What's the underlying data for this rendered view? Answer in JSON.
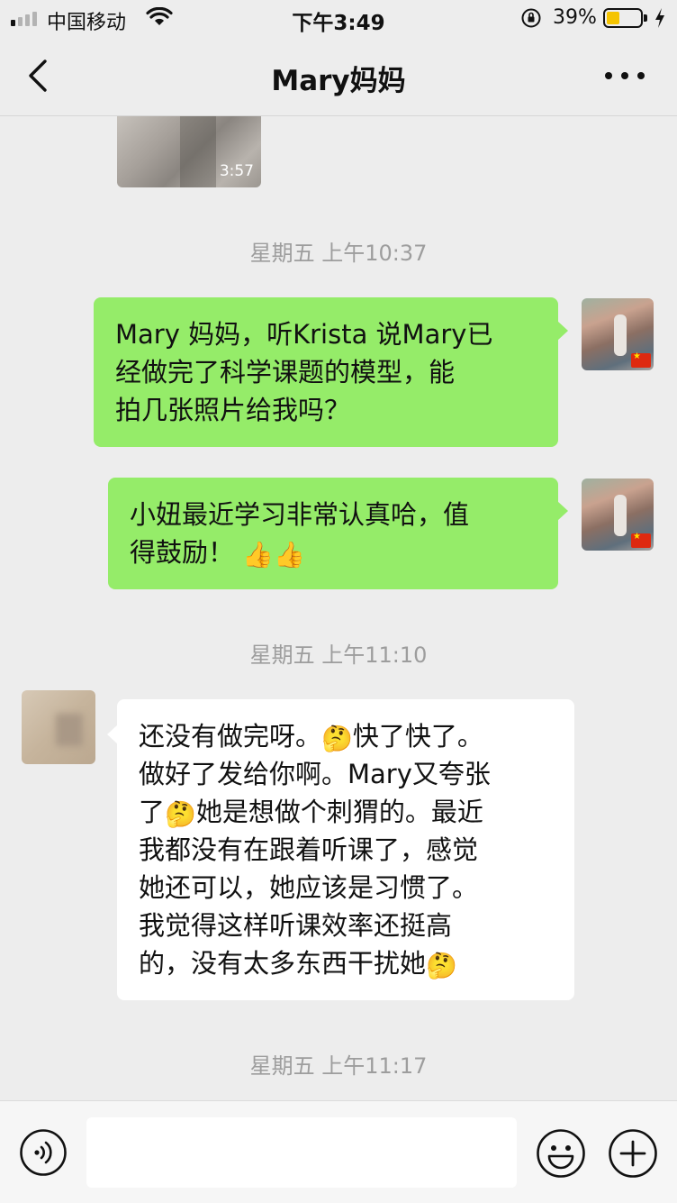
{
  "status_bar": {
    "carrier": "中国移动",
    "time": "下午3:49",
    "battery_percent_text": "39%",
    "battery_level": 0.39,
    "signal_bars_active": 1,
    "signal_bars_total": 4,
    "icons": [
      "signal-icon",
      "wifi-icon",
      "orientation-lock-icon",
      "battery-icon",
      "charging-bolt-icon"
    ]
  },
  "nav": {
    "title": "Mary妈妈",
    "back_icon": "chevron-left-icon",
    "more_icon": "more-dots-icon"
  },
  "chat": {
    "video": {
      "duration": "3:57"
    },
    "timestamps": [
      "星期五 上午10:37",
      "星期五 上午11:10",
      "星期五 上午11:17"
    ],
    "messages": [
      {
        "sender": "self",
        "lines": [
          "Mary 妈妈，听Krista 说Mary已",
          "经做完了科学课题的模型，能",
          "拍几张照片给我吗？"
        ]
      },
      {
        "sender": "self",
        "lines": [
          "小妞最近学习非常认真哈，值",
          "得鼓励！"
        ],
        "emoji": "👍👍"
      },
      {
        "sender": "other",
        "line1_a": "还没有做完呀。",
        "line1_b": "快了快了。",
        "line2": "做好了发给你啊。Mary又夸张",
        "line3_a": "了",
        "line3_b": "她是想做个刺猬的。最近",
        "line4": "我都没有在跟着听课了，感觉",
        "line5": "她还可以，她应该是习惯了。",
        "line6": "我觉得这样听课效率还挺高",
        "line7": "的，没有太多东西干扰她",
        "emoji": "🤔"
      }
    ]
  },
  "input_bar": {
    "text_value": "",
    "icons": [
      "voice-icon",
      "emoji-icon",
      "plus-icon"
    ]
  },
  "colors": {
    "background": "#ededed",
    "bubble_self": "#95ec69",
    "bubble_other": "#ffffff",
    "timestamp_text": "#9d9d9d",
    "battery_fill": "#f5c400"
  }
}
